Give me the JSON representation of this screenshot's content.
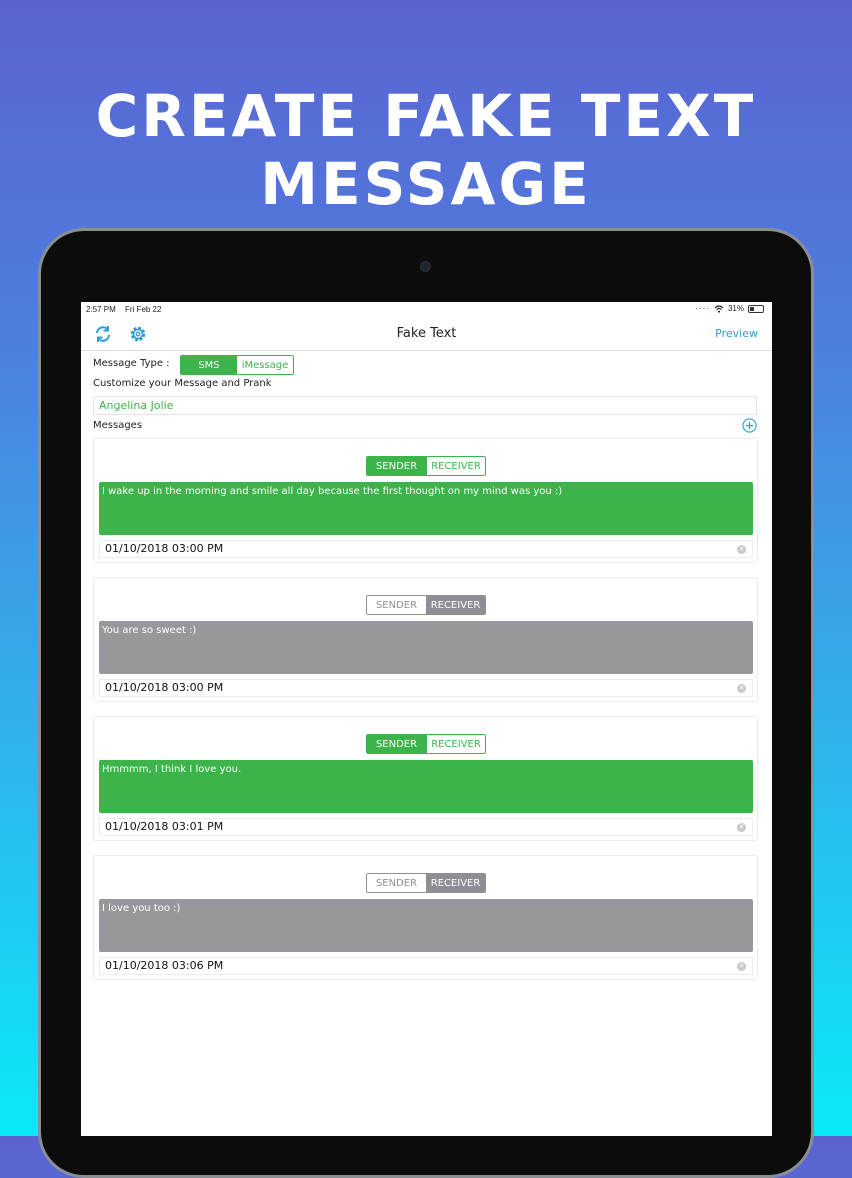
{
  "headline": "CREATE FAKE TEXT MESSAGE",
  "status_bar": {
    "time": "2:57 PM",
    "date": "Fri Feb 22",
    "battery": "31%"
  },
  "navbar": {
    "title": "Fake Text",
    "preview_label": "Preview",
    "refresh_icon": "refresh-icon",
    "settings_icon": "gear-icon"
  },
  "form": {
    "message_type_label": "Message Type :",
    "message_type_options": [
      "SMS",
      "iMessage"
    ],
    "message_type_selected": "SMS",
    "customize_label": "Customize your Message and Prank",
    "contact_name": "Angelina Jolie",
    "messages_label": "Messages"
  },
  "role_labels": {
    "sender": "SENDER",
    "receiver": "RECEIVER"
  },
  "messages": [
    {
      "role": "sender",
      "text": "I wake up in the morning and smile all day because the first thought on my mind was you :)",
      "datetime": "01/10/2018 03:00 PM"
    },
    {
      "role": "receiver",
      "text": "You are so sweet :)",
      "datetime": "01/10/2018 03:00 PM"
    },
    {
      "role": "sender",
      "text": "Hmmmm, I think I love you.",
      "datetime": "01/10/2018 03:01 PM"
    },
    {
      "role": "receiver",
      "text": "I love you too :)",
      "datetime": "01/10/2018 03:06 PM"
    }
  ],
  "colors": {
    "green": "#3cb44a",
    "gray": "#98979c",
    "link_blue": "#2e9bd6"
  }
}
